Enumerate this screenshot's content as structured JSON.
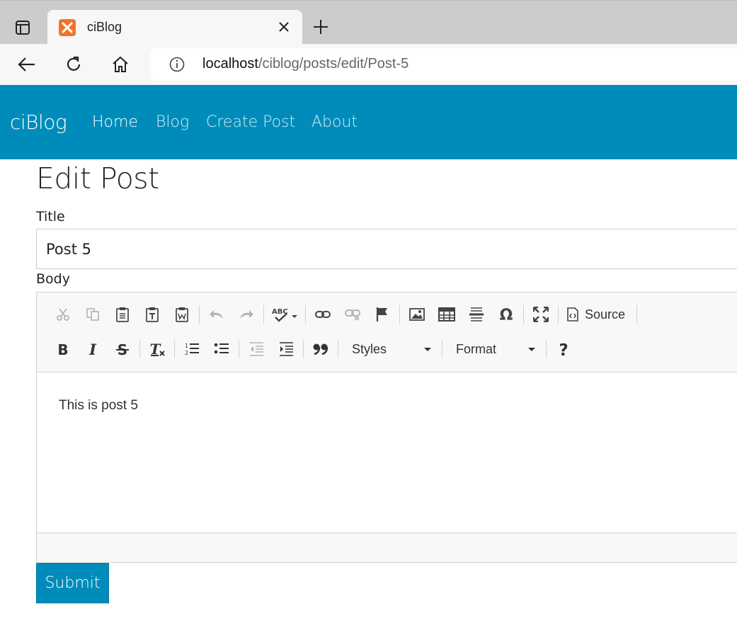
{
  "browser": {
    "tab_title": "ciBlog",
    "url_host": "localhost",
    "url_path": "/ciblog/posts/edit/Post-5"
  },
  "navbar": {
    "brand": "ciBlog",
    "links": [
      "Home",
      "Blog",
      "Create Post",
      "About"
    ],
    "color": "#008cba"
  },
  "page": {
    "heading": "Edit Post",
    "title_label": "Title",
    "title_value": "Post 5",
    "body_label": "Body",
    "body_content": "This is post 5",
    "submit_label": "Submit"
  },
  "editor_toolbar": {
    "source_label": "Source",
    "styles_label": "Styles",
    "format_label": "Format"
  }
}
